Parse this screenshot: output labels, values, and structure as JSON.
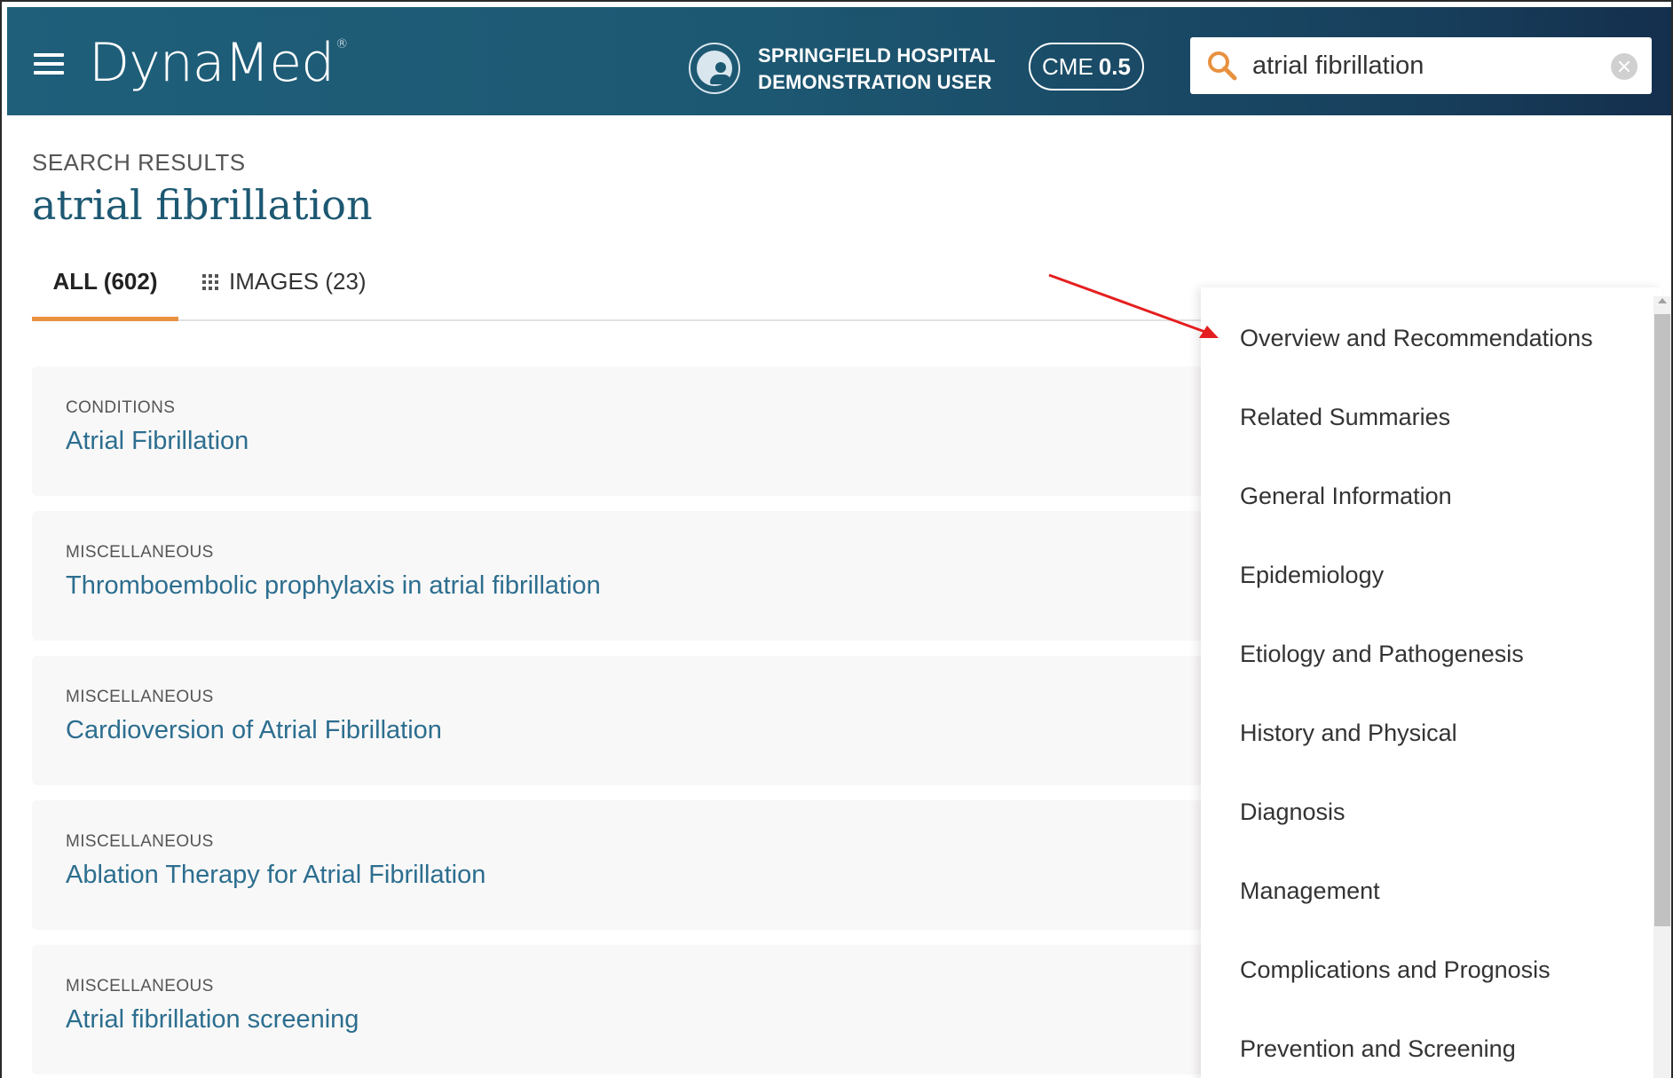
{
  "header": {
    "logo": "DynaMed",
    "logo_mark": "®",
    "user": {
      "line1": "SPRINGFIELD HOSPITAL",
      "line2": "DEMONSTRATION USER"
    },
    "cme": {
      "label": "CME",
      "value": "0.5"
    },
    "search": {
      "value": "atrial fibrillation"
    }
  },
  "results": {
    "label": "SEARCH RESULTS",
    "query": "atrial fibrillation",
    "tabs": [
      {
        "label": "ALL (602)",
        "active": true
      },
      {
        "label": "IMAGES (23)",
        "active": false
      }
    ],
    "items": [
      {
        "category": "CONDITIONS",
        "title": "Atrial Fibrillation"
      },
      {
        "category": "MISCELLANEOUS",
        "title": "Thromboembolic prophylaxis in atrial fibrillation"
      },
      {
        "category": "MISCELLANEOUS",
        "title": "Cardioversion of Atrial Fibrillation"
      },
      {
        "category": "MISCELLANEOUS",
        "title": "Ablation Therapy for Atrial Fibrillation"
      },
      {
        "category": "MISCELLANEOUS",
        "title": "Atrial fibrillation screening"
      }
    ]
  },
  "dropdown": {
    "items": [
      "Overview and Recommendations",
      "Related Summaries",
      "General Information",
      "Epidemiology",
      "Etiology and Pathogenesis",
      "History and Physical",
      "Diagnosis",
      "Management",
      "Complications and Prognosis",
      "Prevention and Screening"
    ]
  },
  "colors": {
    "header_bg": "#1d5872",
    "accent_tab": "#e8913f",
    "link": "#2c6e8f",
    "search_icon": "#e8913f",
    "annotation_arrow": "#e41f1f"
  }
}
